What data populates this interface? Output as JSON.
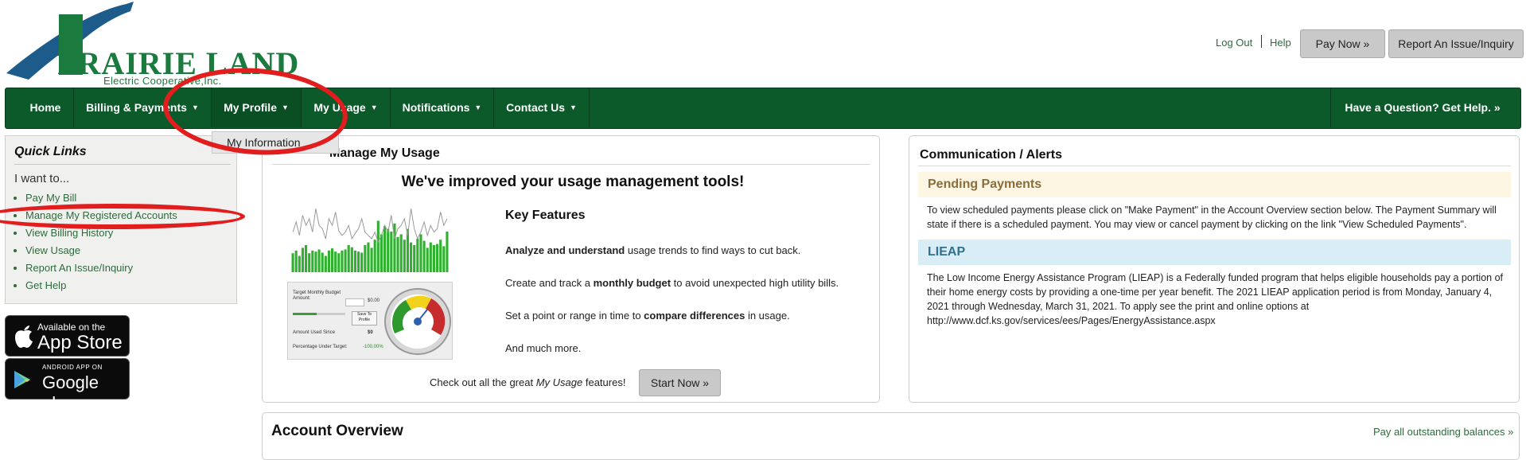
{
  "brand": {
    "logo_text": "PRAIRIE LAND",
    "logo_subtitle": "Electric Cooperative,Inc."
  },
  "header": {
    "logout": "Log Out",
    "help": "Help",
    "pay_now": "Pay Now »",
    "report_issue": "Report An Issue/Inquiry"
  },
  "nav": {
    "items": [
      {
        "label": "Home"
      },
      {
        "label": "Billing & Payments"
      },
      {
        "label": "My Profile"
      },
      {
        "label": "My Usage"
      },
      {
        "label": "Notifications"
      },
      {
        "label": "Contact Us"
      }
    ],
    "help_cta": "Have a Question? Get Help. »",
    "dropdown_item": "My Information"
  },
  "quick_links": {
    "title": "Quick Links",
    "intro": "I want to...",
    "items": [
      "Pay My Bill",
      "Manage My Registered Accounts",
      "View Billing History",
      "View Usage",
      "Report An Issue/Inquiry",
      "Get Help"
    ]
  },
  "app_badges": {
    "apple_small": "Available on the",
    "apple_big": "App Store",
    "google_small": "ANDROID APP ON",
    "google_big": "Google play"
  },
  "usage_panel": {
    "title_partial": "Manage My Usage",
    "headline": "We've improved your usage management tools!",
    "key_features_title": "Key Features",
    "features": [
      {
        "bold": "Analyze and understand",
        "rest": " usage trends to find ways to cut back."
      },
      {
        "pre": "Create and track a ",
        "bold": "monthly budget",
        "rest": " to avoid unexpected high utility bills."
      },
      {
        "pre": "Set a point or range in time to ",
        "bold": "compare differences",
        "rest": " in usage."
      },
      {
        "pre": "And much more.",
        "bold": "",
        "rest": ""
      }
    ],
    "cta_pre": "Check out all the great ",
    "cta_em": "My Usage",
    "cta_post": " features!",
    "start_now": "Start Now »",
    "thumb": {
      "target_budget": "Target Monthly Budget Amount:",
      "amount_used": "Amount Used Since",
      "pct_under": "Percentage Under Target:",
      "save_btn": "Save To Profile",
      "val1": "$0",
      "val2": "$0.00",
      "pct": "-100.00%",
      "bars": [
        0.35,
        0.4,
        0.3,
        0.45,
        0.5,
        0.35,
        0.4,
        0.38,
        0.42,
        0.36,
        0.3,
        0.4,
        0.44,
        0.38,
        0.35,
        0.4,
        0.42,
        0.5,
        0.46,
        0.4,
        0.38,
        0.36,
        0.5,
        0.55,
        0.45,
        0.6,
        0.95,
        0.7,
        0.85,
        0.8,
        0.75,
        0.9,
        0.65,
        0.7,
        0.6,
        0.8,
        0.55,
        0.5,
        0.62,
        0.7,
        0.58,
        0.45,
        0.55,
        0.5,
        0.52,
        0.6,
        0.48,
        0.75
      ],
      "line": [
        0.6,
        0.75,
        0.55,
        0.85,
        0.7,
        0.8,
        0.6,
        0.95,
        0.7,
        0.65,
        0.5,
        0.8,
        0.7,
        0.9,
        0.62,
        0.55,
        0.6,
        0.7,
        0.5,
        0.58,
        0.65,
        0.8,
        0.6,
        0.55,
        0.5,
        0.6,
        0.45,
        0.55,
        0.7,
        0.6,
        0.85,
        0.5,
        0.65,
        0.7,
        0.8,
        0.55,
        0.95,
        0.65,
        0.5,
        0.6,
        0.75,
        0.55,
        0.7,
        0.6,
        0.65,
        0.9,
        0.7,
        0.8
      ]
    }
  },
  "alerts_panel": {
    "title": "Communication / Alerts",
    "alerts": [
      {
        "heading": "Pending Payments",
        "body": "To view scheduled payments please click on \"Make Payment\" in the Account Overview section below. The Payment Summary will state if there is a scheduled payment. You may view or cancel payment by clicking on the link \"View Scheduled Payments\"."
      },
      {
        "heading": "LIEAP",
        "body": "The Low Income Energy Assistance Program (LIEAP) is a Federally funded program that helps eligible households pay a portion of their home energy costs by providing a one-time per year benefit. The 2021 LIEAP application period is from Monday, January 4, 2021 through Wednesday, March 31, 2021. To apply see the print and online options at http://www.dcf.ks.gov/services/ees/Pages/EnergyAssistance.aspx"
      }
    ]
  },
  "account_overview": {
    "title": "Account Overview",
    "pay_all": "Pay all outstanding balances »"
  },
  "colors": {
    "nav_green": "#0c5a2a",
    "link_green": "#2e6b3c",
    "logo_blue": "#1d5c8a",
    "logo_green": "#1b7a3e",
    "annotation_red": "#e11d1d",
    "pending_bg": "#fcf6e3",
    "pending_text": "#8a6d3b",
    "lieap_bg": "#d9edf7",
    "lieap_text": "#31708f"
  }
}
